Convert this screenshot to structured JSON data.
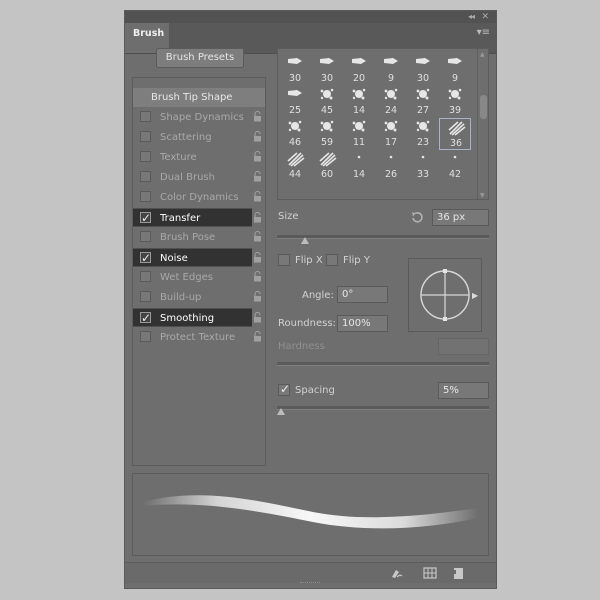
{
  "panel": {
    "tab_label": "Brush",
    "presets_button": "Brush Presets"
  },
  "options_list": [
    {
      "label": "Brush Tip Shape",
      "checked": false,
      "header": true
    },
    {
      "label": "Shape Dynamics",
      "checked": false
    },
    {
      "label": "Scattering",
      "checked": false
    },
    {
      "label": "Texture",
      "checked": false
    },
    {
      "label": "Dual Brush",
      "checked": false
    },
    {
      "label": "Color Dynamics",
      "checked": false
    },
    {
      "label": "Transfer",
      "checked": true
    },
    {
      "label": "Brush Pose",
      "checked": false
    },
    {
      "label": "Noise",
      "checked": true
    },
    {
      "label": "Wet Edges",
      "checked": false
    },
    {
      "label": "Build-up",
      "checked": false
    },
    {
      "label": "Smoothing",
      "checked": true
    },
    {
      "label": "Protect Texture",
      "checked": false
    }
  ],
  "brush_tips": {
    "rows": [
      [
        "30",
        "30",
        "20",
        "9",
        "30",
        "9"
      ],
      [
        "25",
        "45",
        "14",
        "24",
        "27",
        "39"
      ],
      [
        "46",
        "59",
        "11",
        "17",
        "23",
        "36"
      ],
      [
        "44",
        "60",
        "14",
        "26",
        "33",
        "42"
      ]
    ],
    "selected": "36"
  },
  "tip_shape": {
    "size_label": "Size",
    "size_value": "36 px",
    "size_fraction": 0.13,
    "flip_x_label": "Flip X",
    "flip_y_label": "Flip Y",
    "angle_label": "Angle:",
    "angle_value": "0°",
    "roundness_label": "Roundness:",
    "roundness_value": "100%",
    "hardness_label": "Hardness",
    "spacing_label": "Spacing",
    "spacing_value": "5%",
    "spacing_checked": true,
    "spacing_fraction": 0.02
  },
  "icons": {
    "collapse": "double-chevron-icon",
    "close": "close-icon",
    "panel_menu": "panel-menu-icon",
    "lock": "lock-icon",
    "reset": "reset-size-icon",
    "toggle_live_tip": "brush-preview-icon",
    "open_preset_manager": "grid-icon",
    "new_preset": "new-page-icon"
  }
}
